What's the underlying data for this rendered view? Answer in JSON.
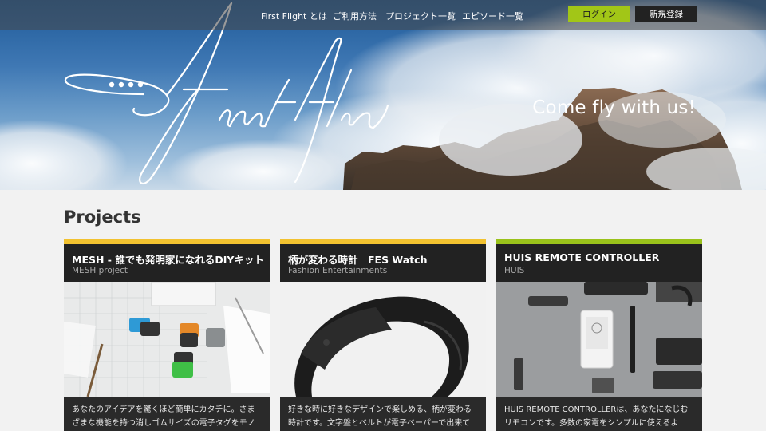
{
  "header": {
    "nav": [
      {
        "label": "First Flight とは"
      },
      {
        "label": "ご利用方法"
      },
      {
        "label": "プロジェクト一覧"
      },
      {
        "label": "エピソード一覧"
      }
    ],
    "login_label": "ログイン",
    "register_label": "新規登録"
  },
  "hero": {
    "tagline": "Come fly with us!"
  },
  "projects": {
    "title": "Projects",
    "cards": [
      {
        "title": "MESH - 誰でも発明家になれるDIYキット",
        "subtitle": "MESH project",
        "description": "あなたのアイデアを驚くほど簡単にカタチに。さまざまな機能を持つ消しゴムサイズの電子タグをモノ",
        "accent": "#f2c230"
      },
      {
        "title": "柄が変わる時計　FES Watch",
        "subtitle": "Fashion Entertainments",
        "description": "好きな時に好きなデザインで楽しめる、柄が変わる時計です。文字盤とベルトが電子ペーパーで出来て",
        "accent": "#f2c230"
      },
      {
        "title": "HUIS REMOTE CONTROLLER",
        "subtitle": "HUIS",
        "description": "HUIS REMOTE CONTROLLERは、あなたになじむリモコンです。多数の家電をシンプルに使えるよ　あ",
        "accent": "#9ac21b"
      }
    ]
  }
}
